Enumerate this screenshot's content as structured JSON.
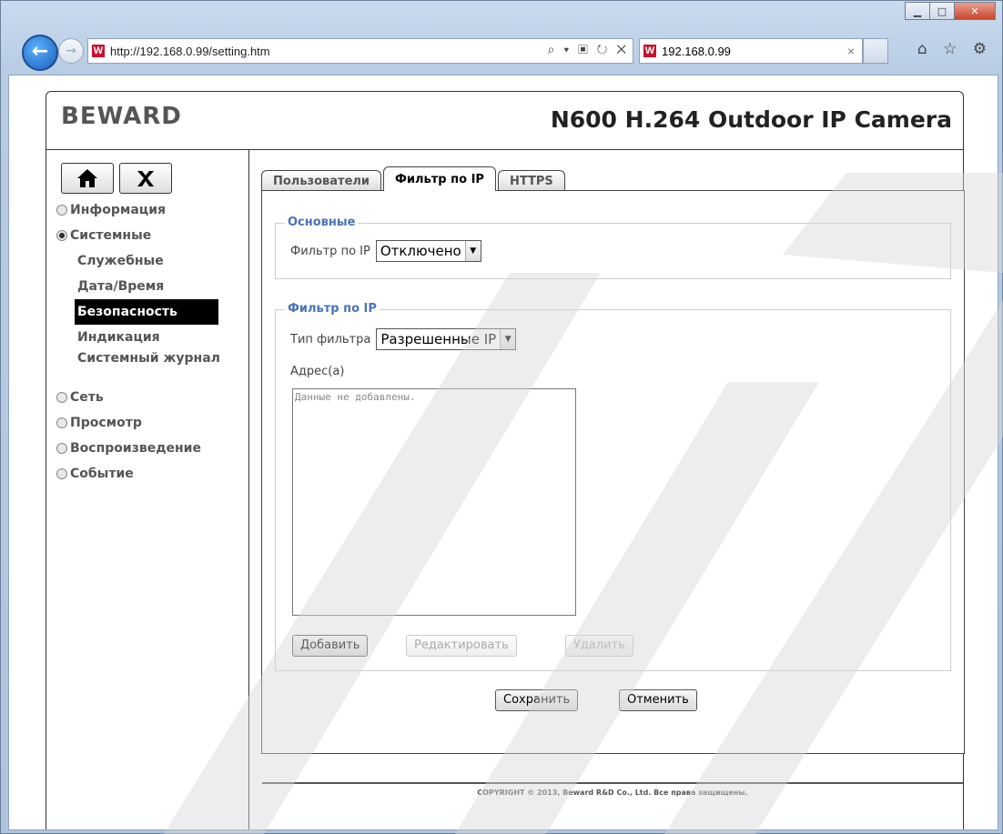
{
  "browser": {
    "url": "http://192.168.0.99/setting.htm",
    "tab_title": "192.168.0.99",
    "favicon_letter": "W",
    "address_tools": "⌕ ▾ ▣ ↻ ✕",
    "right_tools": "⌂ ☆ ⚙",
    "window_buttons": {
      "minimize": "▁",
      "maximize": "□",
      "close": "✕"
    }
  },
  "header": {
    "logo": "BEWARD",
    "model": "N600 H.264 Outdoor IP Camera"
  },
  "sidebar": {
    "home_icon": "home-icon",
    "tools_icon": "tools-icon",
    "items": [
      {
        "label": "Информация",
        "expanded": false
      },
      {
        "label": "Системные",
        "expanded": true
      },
      {
        "label": "Сеть",
        "expanded": false
      },
      {
        "label": "Просмотр",
        "expanded": false
      },
      {
        "label": "Воспроизведение",
        "expanded": false
      },
      {
        "label": "Событие",
        "expanded": false
      }
    ],
    "subitems": [
      "Служебные",
      "Дата/Время",
      "Безопасность",
      "Индикация",
      "Системный журнал"
    ],
    "active_subitem": "Безопасность"
  },
  "tabs": [
    "Пользователи",
    "Фильтр по IP",
    "HTTPS"
  ],
  "active_tab": "Фильтр по IP",
  "basic": {
    "legend": "Основные",
    "filter_label": "Фильтр по IP",
    "filter_value": "Отключено"
  },
  "ipfilter": {
    "legend": "Фильтр по IP",
    "type_label": "Тип фильтра",
    "type_value": "Разрешенные IP",
    "address_label": "Адрес(а)",
    "empty_text": "Данные не добавлены.",
    "add": "Добавить",
    "edit": "Редактировать",
    "delete": "Удалить"
  },
  "actions": {
    "save": "Сохранить",
    "cancel": "Отменить"
  },
  "footer": {
    "copyright": "COPYRIGHT © 2013, Beward R&D Co., Ltd. Все права защищены."
  },
  "colors": {
    "legend": "#4a73b8",
    "active_nav": "#000000",
    "logo": "#555555"
  }
}
